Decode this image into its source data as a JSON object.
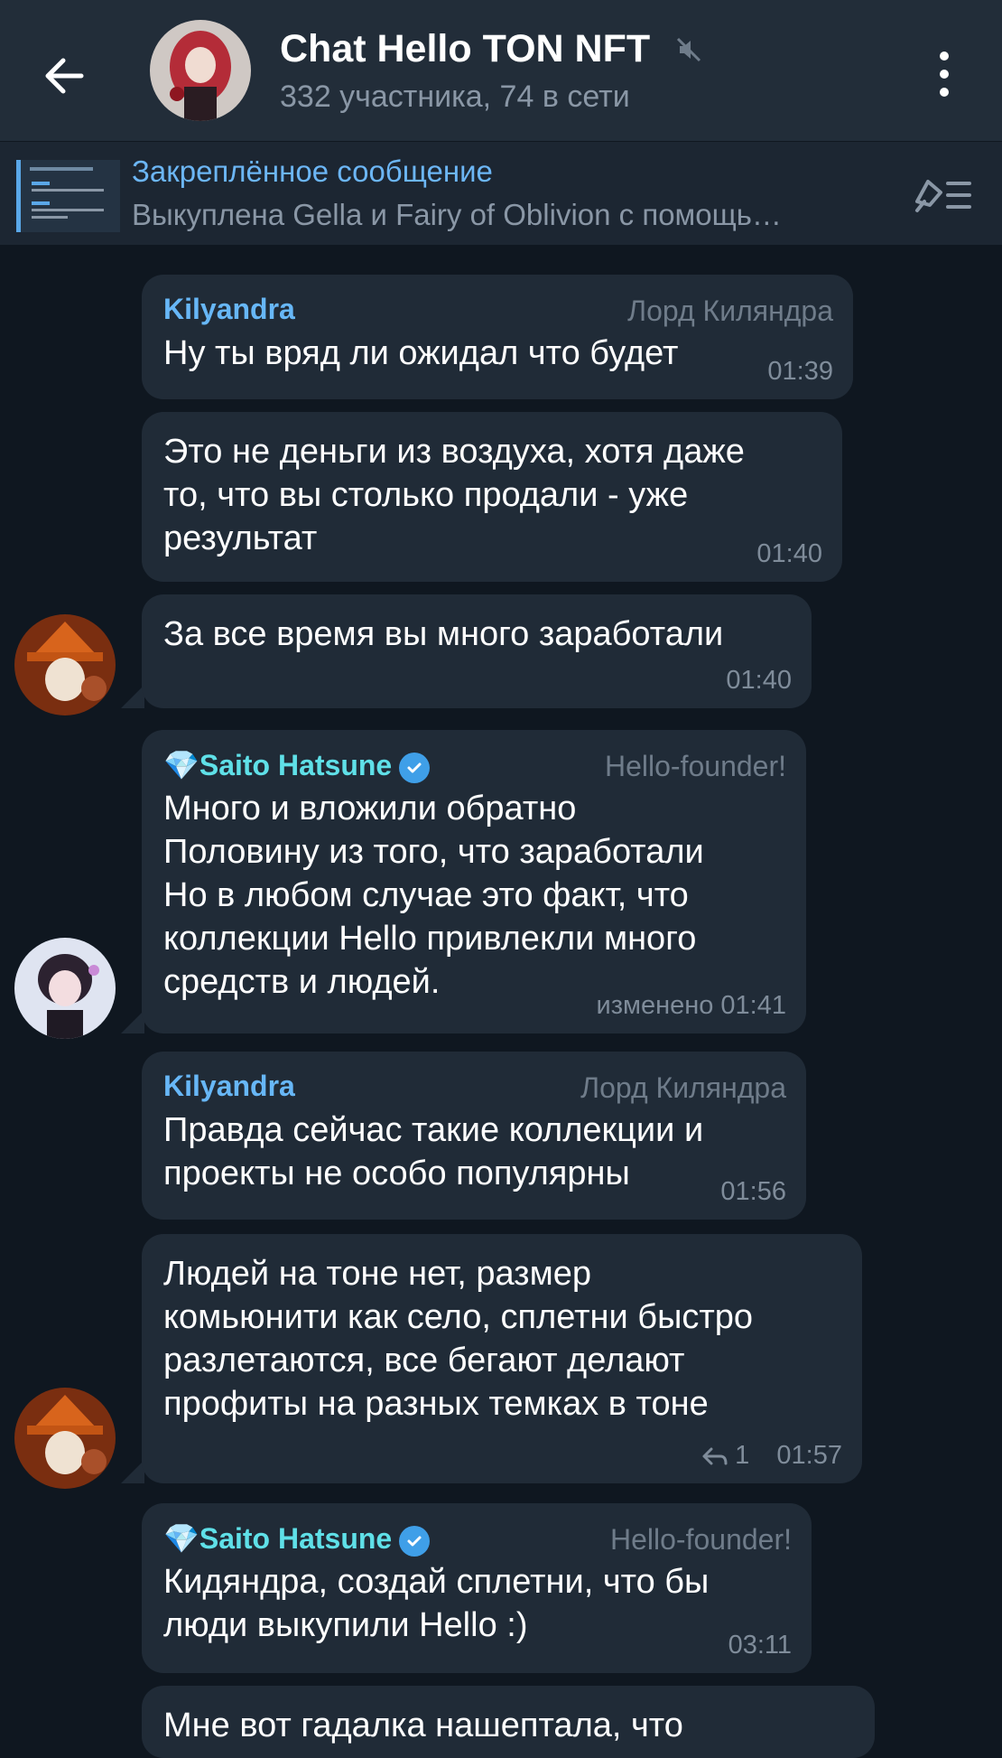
{
  "header": {
    "title": "Chat Hello TON NFT",
    "subtitle": "332 участника, 74 в сети",
    "icons": [
      "arrow-left-icon",
      "mute-icon",
      "more-vertical-icon"
    ]
  },
  "pinned": {
    "title": "Закреплённое сообщение",
    "text": "Выкуплена Gella и Fairy of Oblivion с помощь…",
    "icon": "unpin-icon"
  },
  "messages": [
    {
      "sender": "Kilyandra",
      "rank": "Лорд Киляндра",
      "text": "Ну ты вряд ли ожидал что будет",
      "time": "01:39"
    },
    {
      "text": "Это не деньги из воздуха, хотя даже\nто, что вы столько продали - уже\nрезультат",
      "time": "01:40"
    },
    {
      "text": "За все время вы много заработали",
      "time": "01:40"
    },
    {
      "sender": "💎Saito Hatsune",
      "rank": "Hello-founder!",
      "text": "Много и вложили обратно\nПоловину из того, что заработали\nНо в любом случае это факт, что\nколлекции Hello привлекли много\nсредств и людей.",
      "time": "изменено 01:41"
    },
    {
      "sender": "Kilyandra",
      "rank": "Лорд Киляндра",
      "text": "Правда сейчас такие коллекции и\nпроекты не особо популярны",
      "time": "01:56"
    },
    {
      "text": "Людей на тоне нет, размер\nкомьюнити как село, сплетни быстро\nразлетаются, все бегают делают\nпрофиты на разных темках в тоне",
      "replies": "1",
      "time": "01:57"
    },
    {
      "sender": "💎Saito Hatsune",
      "rank": "Hello-founder!",
      "text": "Кидяндра, создай сплетни, что бы\nлюди выкупили Hello :)",
      "time": "03:11"
    },
    {
      "text": "Мне вот гадалка нашептала, что"
    }
  ],
  "colors": {
    "background": "#0f1720",
    "header": "#222d39",
    "bubble": "#202b37",
    "sender_blue": "#67b7f7",
    "sender_cyan": "#5fe0e8",
    "meta_gray": "#7f8c9a"
  }
}
